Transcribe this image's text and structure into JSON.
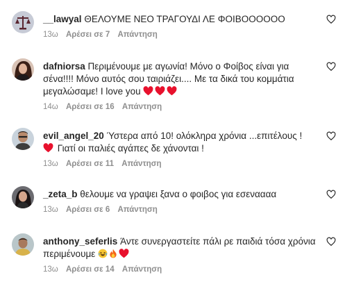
{
  "comments": [
    {
      "username": "__lawyal",
      "text": "ΘΕΛΟΥΜΕ ΝΕΟ ΤΡΑΓΟΥΔΙ ΛΕ ΦΟΙΒΟΟΟΟΟΟ",
      "time": "13ω",
      "likes": "Αρέσει σε 7",
      "reply": "Απάντηση",
      "avatar_icon": "scales-avatar"
    },
    {
      "username": "dafniorsa",
      "text": "Περιμένουμε με αγωνία! Μόνο ο Φοίβος είναι για σένα!!!! Μόνο αυτός σου ταιριάζει.... Με τα δικά του κομμάτια μεγαλώσαμε! I love you",
      "emojis": [
        "red-heart",
        "red-heart",
        "red-heart"
      ],
      "time": "14ω",
      "likes": "Αρέσει σε 16",
      "reply": "Απάντηση",
      "avatar_icon": "woman-avatar"
    },
    {
      "username": "evil_angel_20",
      "text_part1": "Ύστερα από 10! ολόκληρα χρόνια ...επιτέλους !",
      "text_part2": "Γιατί οι παλιές αγάπες δε χάνονται !",
      "time": "13ω",
      "likes": "Αρέσει σε 11",
      "reply": "Απάντηση",
      "avatar_icon": "man-avatar"
    },
    {
      "username": "_zeta_b",
      "text": "θελουμε να γραψει ξανα ο φοιβος για εσεναααα",
      "time": "13ω",
      "likes": "Αρέσει σε 6",
      "reply": "Απάντηση",
      "avatar_icon": "woman-avatar"
    },
    {
      "username": "anthony_seferlis",
      "text": "Άντε συνεργαστείτε πάλι ρε παιδιά τόσα χρόνια περιμένουμε",
      "emojis": [
        "laughing-face",
        "fire",
        "red-heart"
      ],
      "time": "13ω",
      "likes": "Αρέσει σε 14",
      "reply": "Απάντηση",
      "avatar_icon": "man-avatar"
    }
  ],
  "colors": {
    "text": "#262626",
    "secondary": "#8e8e8e",
    "heart_emoji": "#e8112d"
  },
  "like_icon": "heart-outline-icon"
}
